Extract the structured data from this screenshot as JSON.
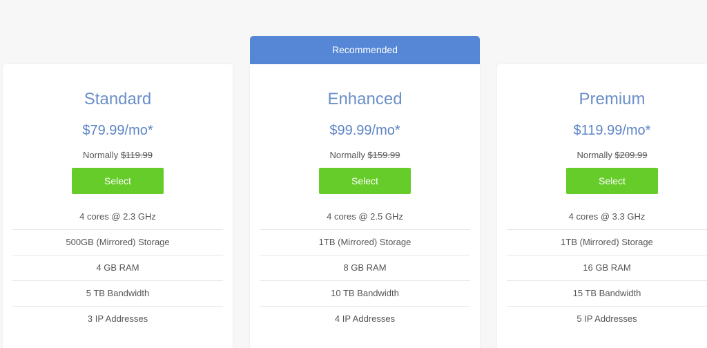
{
  "recommended_label": "Recommended",
  "normally_label": "Normally",
  "plans": [
    {
      "name": "Standard",
      "price": "$79.99/mo*",
      "old_price": "$119.99",
      "select_label": "Select",
      "features": [
        "4 cores @ 2.3 GHz",
        "500GB (Mirrored) Storage",
        "4 GB RAM",
        "5 TB Bandwidth",
        "3 IP Addresses"
      ]
    },
    {
      "name": "Enhanced",
      "price": "$99.99/mo*",
      "old_price": "$159.99",
      "select_label": "Select",
      "features": [
        "4 cores @ 2.5 GHz",
        "1TB (Mirrored) Storage",
        "8 GB RAM",
        "10 TB Bandwidth",
        "4 IP Addresses"
      ]
    },
    {
      "name": "Premium",
      "price": "$119.99/mo*",
      "old_price": "$209.99",
      "select_label": "Select",
      "features": [
        "4 cores @ 3.3 GHz",
        "1TB (Mirrored) Storage",
        "16 GB RAM",
        "15 TB Bandwidth",
        "5 IP Addresses"
      ]
    }
  ],
  "colors": {
    "banner": "#5587d6",
    "plan_name": "#6a8fc9",
    "price": "#5d84c4",
    "button": "#66cc2a",
    "background": "#f7f7f7"
  }
}
